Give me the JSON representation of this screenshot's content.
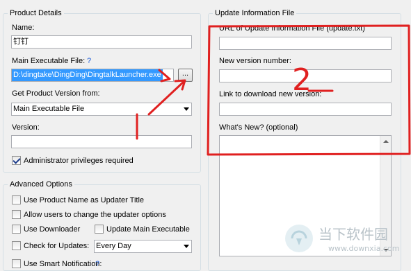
{
  "product_details": {
    "title": "Product Details",
    "name_label": "Name:",
    "name_value": "钉钉",
    "exe_label": "Main Executable File:",
    "exe_help": "?",
    "exe_value": "D:\\dingtake\\DingDing\\DingtalkLauncher.exe",
    "browse_label": "...",
    "version_from_label": "Get Product Version from:",
    "version_from_value": "Main Executable File",
    "version_label": "Version:",
    "version_value": "",
    "admin_label": "Administrator privileges required",
    "admin_checked": true
  },
  "advanced": {
    "title": "Advanced Options",
    "use_product_name": "Use Product Name as Updater Title",
    "allow_change": "Allow users to change the updater options",
    "use_downloader": "Use Downloader",
    "update_main_exe": "Update Main Executable",
    "check_updates": "Check for Updates:",
    "check_updates_value": "Every Day",
    "smart_notification": "Use Smart Notification:",
    "smart_help": "?"
  },
  "update_info": {
    "title": "Update Information File",
    "url_label": "URL of Update Information File (update.txt)",
    "url_value": "",
    "new_version_label": "New version number:",
    "new_version_value": "",
    "link_label": "Link to download new version:",
    "link_value": "",
    "whats_new_label": "What's New? (optional)",
    "whats_new_value": ""
  },
  "annotations": {
    "number": "2",
    "color": "#e02020"
  },
  "watermark": {
    "site_name": "当下软件园",
    "url": "www.downxia.com"
  }
}
